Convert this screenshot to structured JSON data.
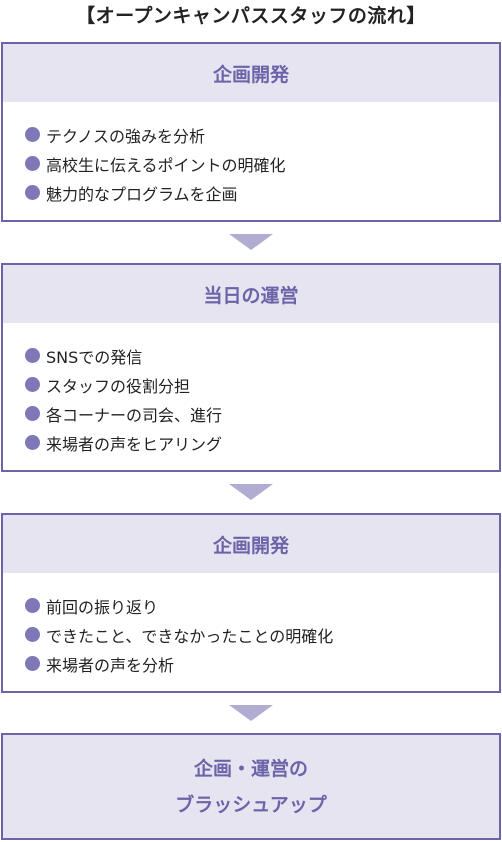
{
  "title": "【オープンキャンパススタッフの流れ】",
  "stages": [
    {
      "heading": "企画開発",
      "items": [
        "テクノスの強みを分析",
        "高校生に伝えるポイントの明確化",
        "魅力的なプログラムを企画"
      ]
    },
    {
      "heading": "当日の運営",
      "items": [
        "SNSでの発信",
        "スタッフの役割分担",
        "各コーナーの司会、進行",
        "来場者の声をヒアリング"
      ]
    },
    {
      "heading": "企画開発",
      "items": [
        "前回の振り返り",
        "できたこと、できなかったことの明確化",
        "来場者の声を分析"
      ]
    }
  ],
  "final": {
    "line1": "企画・運営の",
    "line2": "ブラッシュアップ"
  },
  "colors": {
    "border": "#6b64a8",
    "header_bg": "#e6e4f1",
    "bullet": "#7e78b6",
    "arrow": "#b0acd2"
  }
}
